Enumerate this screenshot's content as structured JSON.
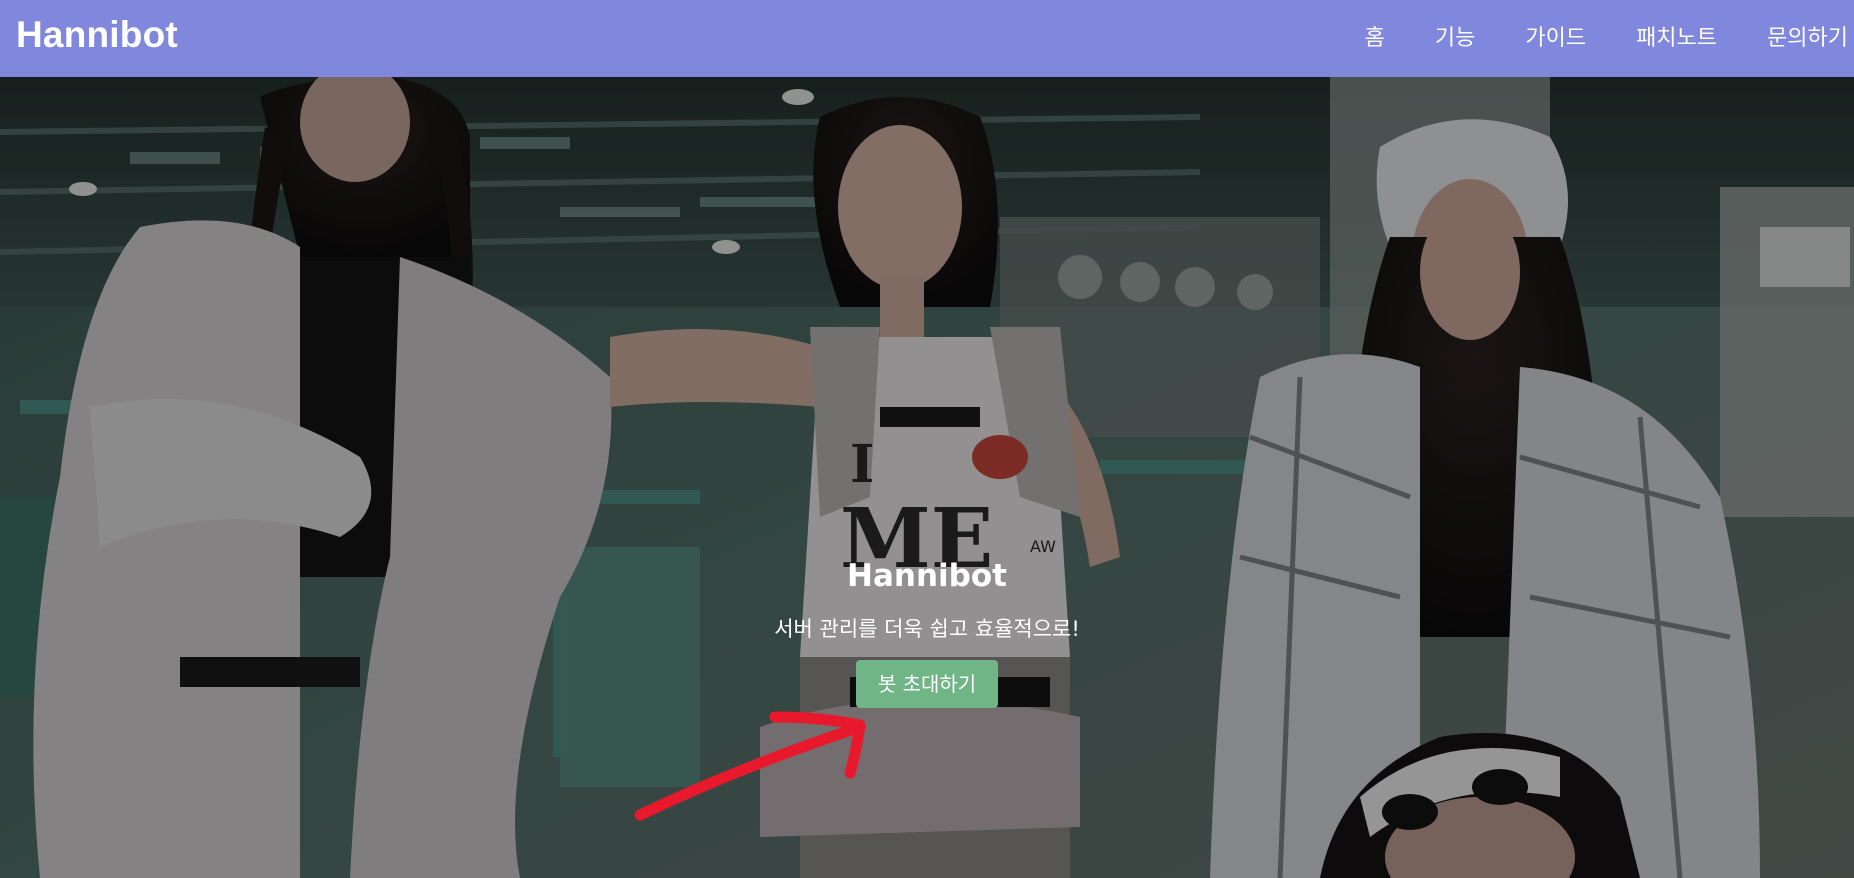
{
  "header": {
    "brand": "Hannibot",
    "background_color": "#7f88dc",
    "nav": [
      {
        "label": "홈"
      },
      {
        "label": "기능"
      },
      {
        "label": "가이드"
      },
      {
        "label": "패치노트"
      },
      {
        "label": "문의하기"
      }
    ]
  },
  "hero": {
    "title": "Hannibot",
    "subtitle": "서버 관리를 더욱 쉽고 효율적으로!",
    "cta_label": "봇 초대하기",
    "cta_color": "#6fb585",
    "annotation_color": "#e8192c",
    "shirt_text_line1": "I",
    "shirt_text_line2": "ME",
    "shirt_text_small": "AW"
  }
}
